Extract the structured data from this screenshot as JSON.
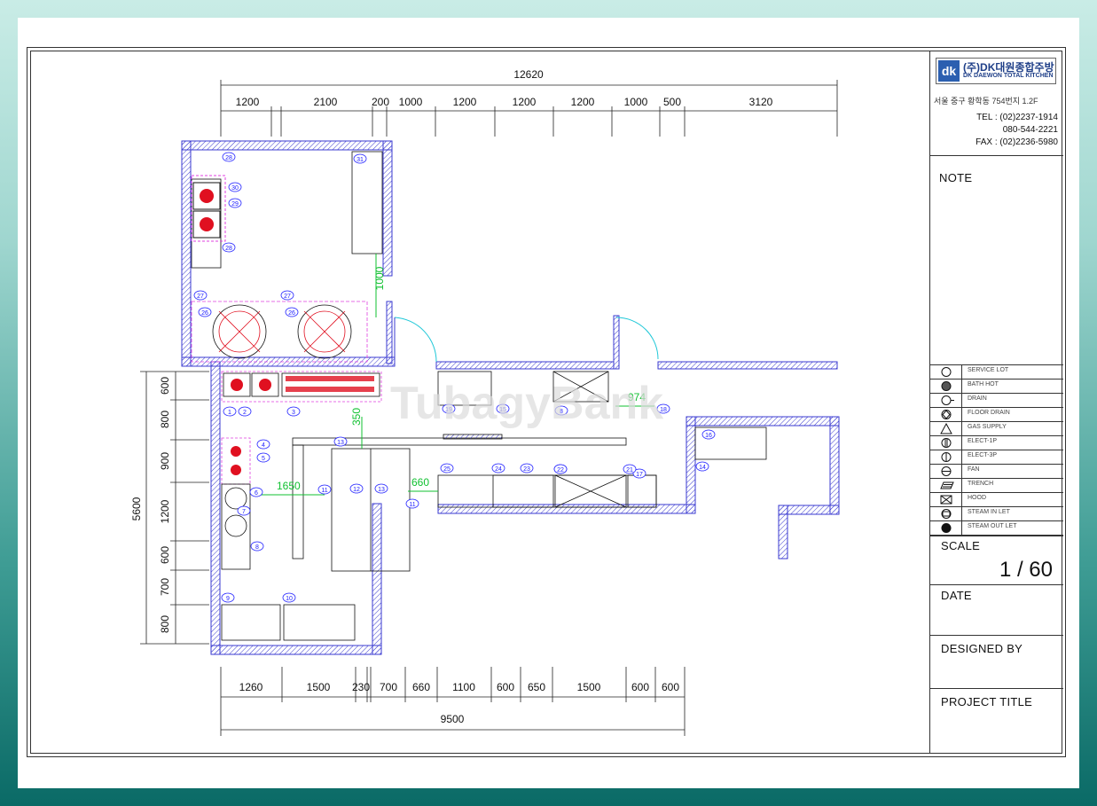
{
  "company": {
    "logo_mark": "dk",
    "name": "(주)DK대원종합주방",
    "name_en": "DK DAEWON TOTAL KITCHEN",
    "address": "서울 중구 황학동 754번지 1.2F",
    "tel_label": "TEL : (02)2237-1914",
    "tel2": "080-544-2221",
    "fax_label": "FAX : (02)2236-5980"
  },
  "title_block": {
    "note_label": "NOTE",
    "scale_label": "SCALE",
    "scale_value": "1 / 60",
    "date_label": "DATE",
    "designed_by_label": "DESIGNED BY",
    "project_title_label": "PROJECT TITLE"
  },
  "legend": [
    {
      "symbol": "open-circle",
      "text": "SERVICE LOT"
    },
    {
      "symbol": "hatched-circle",
      "text": "BATH HOT"
    },
    {
      "symbol": "circle-tick",
      "text": "DRAIN"
    },
    {
      "symbol": "diamond-circle",
      "text": "FLOOR DRAIN"
    },
    {
      "symbol": "triangle",
      "text": "GAS SUPPLY"
    },
    {
      "symbol": "circle-double-bar",
      "text": "ELECT-1P"
    },
    {
      "symbol": "circle-bar",
      "text": "ELECT-3P"
    },
    {
      "symbol": "circle-hline",
      "text": "FAN"
    },
    {
      "symbol": "hatched-para",
      "text": "TRENCH"
    },
    {
      "symbol": "x-box",
      "text": "HOOD"
    },
    {
      "symbol": "circle-box",
      "text": "STEAM IN LET"
    },
    {
      "symbol": "filled-octagon",
      "text": "STEAM OUT LET"
    }
  ],
  "dimensions": {
    "top_total": "12620",
    "top_segments": [
      "1200",
      "2100",
      "200",
      "1000",
      "1200",
      "1200",
      "1200",
      "1000",
      "500",
      "3120"
    ],
    "bottom_segments": [
      "1260",
      "1500",
      "230",
      "700",
      "660",
      "1100",
      "600",
      "650",
      "1500",
      "600",
      "600"
    ],
    "bottom_total": "9500",
    "left_total": "5600",
    "left_segments": [
      "600",
      "800",
      "900",
      "1200",
      "600",
      "700",
      "800"
    ],
    "inner_1000": "1000",
    "inner_1650": "1650",
    "inner_660": "660",
    "inner_350": "350",
    "inner_974": "974"
  },
  "equipment_numbers": [
    "1",
    "2",
    "3",
    "4",
    "5",
    "6",
    "7",
    "8",
    "9",
    "10",
    "11",
    "12",
    "13",
    "14",
    "15",
    "16",
    "17",
    "18",
    "19",
    "20",
    "21",
    "22",
    "23",
    "24",
    "25",
    "26",
    "27",
    "28",
    "29",
    "30",
    "31"
  ],
  "watermark": "TubagyBank",
  "colors": {
    "wall": "#3a3ad0",
    "equipment": "#1a1a1a",
    "marker": "#2020ff",
    "burner": "#e01020",
    "dashed": "#e040e0",
    "dim_green": "#10c030",
    "door": "#20c8d8"
  }
}
